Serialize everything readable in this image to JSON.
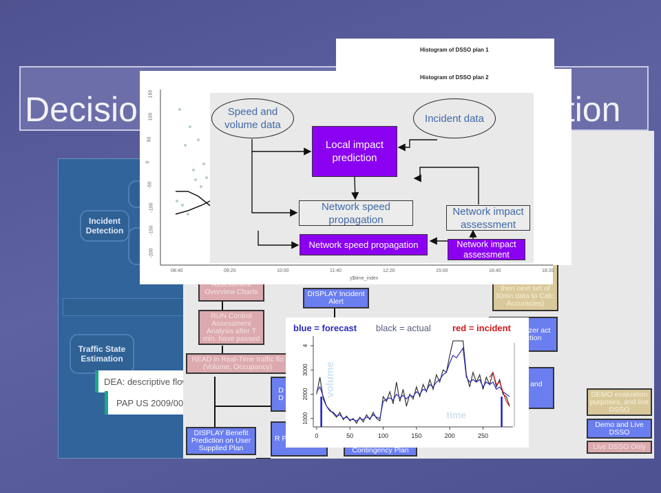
{
  "slide_title": {
    "left": "Decisio",
    "right": "ation"
  },
  "left_panel": {
    "incident_detection": "Incident Detection",
    "traffic_state_estimation": "Traffic State Estimation",
    "note_dea": "DEA: descriptive flow r",
    "note_pap": "PAP US 2009/009"
  },
  "flow": {
    "assessment_charts": "Assessment Overview Charts",
    "run_control": "RUN Control Assessment Analysis after T min. have passed",
    "read_realtime": "READ in Real-Time traffic flo (Volume, Occupancy)",
    "d_box": "D\nD",
    "display_benefit": "DISPLAY Benefit Prediction on User Supplied Plan",
    "r_box": "R Pr Us plan",
    "display_alert": "DISPLAY Incident Alert",
    "contingency": "Contingency Plan",
    "calc_accuracies": "then next set of 30mn data to Calc. Accuracies)",
    "control_optimizer": "ontrol ptimizer act and ediction",
    "top3": "Top 3 ol ns and kely fit",
    "legend_demo_eval": "DEMO evaluation purposes, and live DSSO",
    "legend_demo_live": "Demo and Live DSSO",
    "legend_live_only": "Live DSSO Only"
  },
  "histograms": {
    "plan1": "Histogram of DSSO plan 1",
    "plan2": "Histogram of DSSO plan 2"
  },
  "scatter": {
    "yticks": [
      "150",
      "100",
      "50",
      "0",
      "-50",
      "-100",
      "-150",
      "-200"
    ],
    "xticks": [
      "08:40",
      "09:20",
      "10:00",
      "11:40",
      "12:20",
      "15:00",
      "16:40",
      "18:20"
    ],
    "xlabel": "y$time_index"
  },
  "diagram": {
    "speed_volume": "Speed and volume data",
    "incident_data": "Incident data",
    "local_impact": "Local impact prediction",
    "net_speed_1": "Network speed propagation",
    "net_impact_1": "Network impact assessment",
    "net_speed_2": "Network speed propagation",
    "net_impact_2": "Network impact assessment",
    "colors": {
      "purple": "#8b00f0",
      "text_blue": "#3f68a8"
    }
  },
  "chart_data": {
    "type": "line",
    "legend": {
      "forecast": "blue = forecast",
      "actual": "black = actual",
      "incident": "red = incident"
    },
    "xlabel": "time",
    "ylabel": "volume",
    "xticks": [
      0,
      50,
      100,
      150,
      200,
      250
    ],
    "yticks": [
      1000,
      2000,
      3000,
      4
    ],
    "ytick_labels": [
      "1000",
      "2000",
      "3000",
      "4"
    ],
    "xlim": [
      -5,
      295
    ],
    "ylim": [
      650,
      4400
    ],
    "x_step": 5,
    "series": [
      {
        "name": "black = actual",
        "color": "#333333",
        "values": [
          2000,
          2700,
          1800,
          1500,
          1350,
          1200,
          1050,
          1250,
          950,
          1100,
          900,
          1000,
          800,
          1050,
          850,
          1150,
          950,
          1250,
          1000,
          900,
          1900,
          1700,
          2100,
          1600,
          2500,
          1700,
          2200,
          1500,
          2000,
          1800,
          2300,
          1900,
          2400,
          2100,
          2600,
          2200,
          2800,
          2500,
          3000,
          2900,
          3600,
          4200,
          4200,
          4200,
          4200,
          2800,
          2300,
          2900,
          2500,
          2800,
          2200,
          2700,
          2400,
          2900,
          2300,
          2600,
          2000,
          1900,
          1500
        ]
      },
      {
        "name": "blue = forecast",
        "color": "#2a2ab8",
        "values": [
          2100,
          2300,
          1900,
          1500,
          1300,
          1250,
          1100,
          1150,
          1000,
          1050,
          950,
          950,
          900,
          1000,
          950,
          1050,
          1000,
          1150,
          1050,
          1000,
          1700,
          1800,
          1850,
          1750,
          2000,
          1850,
          1950,
          1800,
          1950,
          1900,
          2100,
          2000,
          2200,
          2150,
          2400,
          2300,
          2500,
          2600,
          2800,
          2900,
          3300,
          3600,
          3500,
          3700,
          3900,
          2700,
          2500,
          2600,
          2500,
          2600,
          2300,
          2500,
          2400,
          2500,
          2200,
          2300,
          2100,
          2000,
          1900
        ]
      },
      {
        "name": "red = incident",
        "color": "#d01818",
        "x_start": 260,
        "values": [
          2700,
          2900,
          2400,
          2500,
          2100,
          1700,
          1500
        ]
      }
    ],
    "vertical_markers": [
      7,
      278
    ]
  }
}
